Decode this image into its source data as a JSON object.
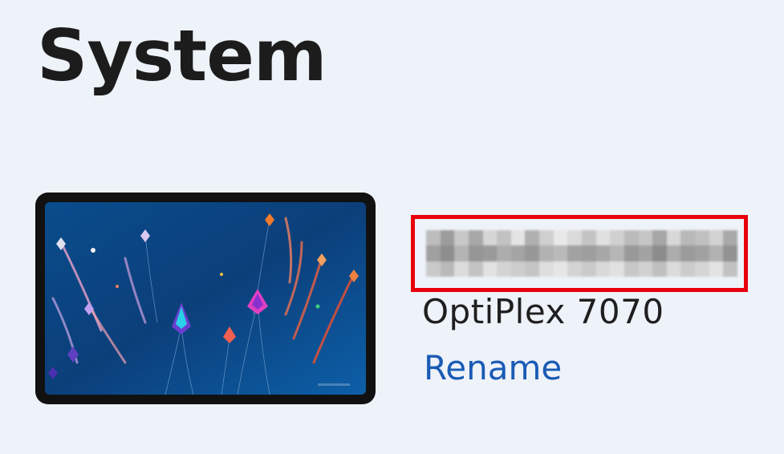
{
  "page": {
    "title": "System"
  },
  "device": {
    "name_redacted": true,
    "model": "OptiPlex 7070",
    "rename_label": "Rename"
  },
  "colors": {
    "background": "#eef2f9",
    "highlight_border": "#e8000b",
    "link": "#1a5bb5",
    "title_text": "#1c1c1c"
  },
  "icons": {
    "wallpaper_preview": "kites-wallpaper-thumbnail"
  }
}
